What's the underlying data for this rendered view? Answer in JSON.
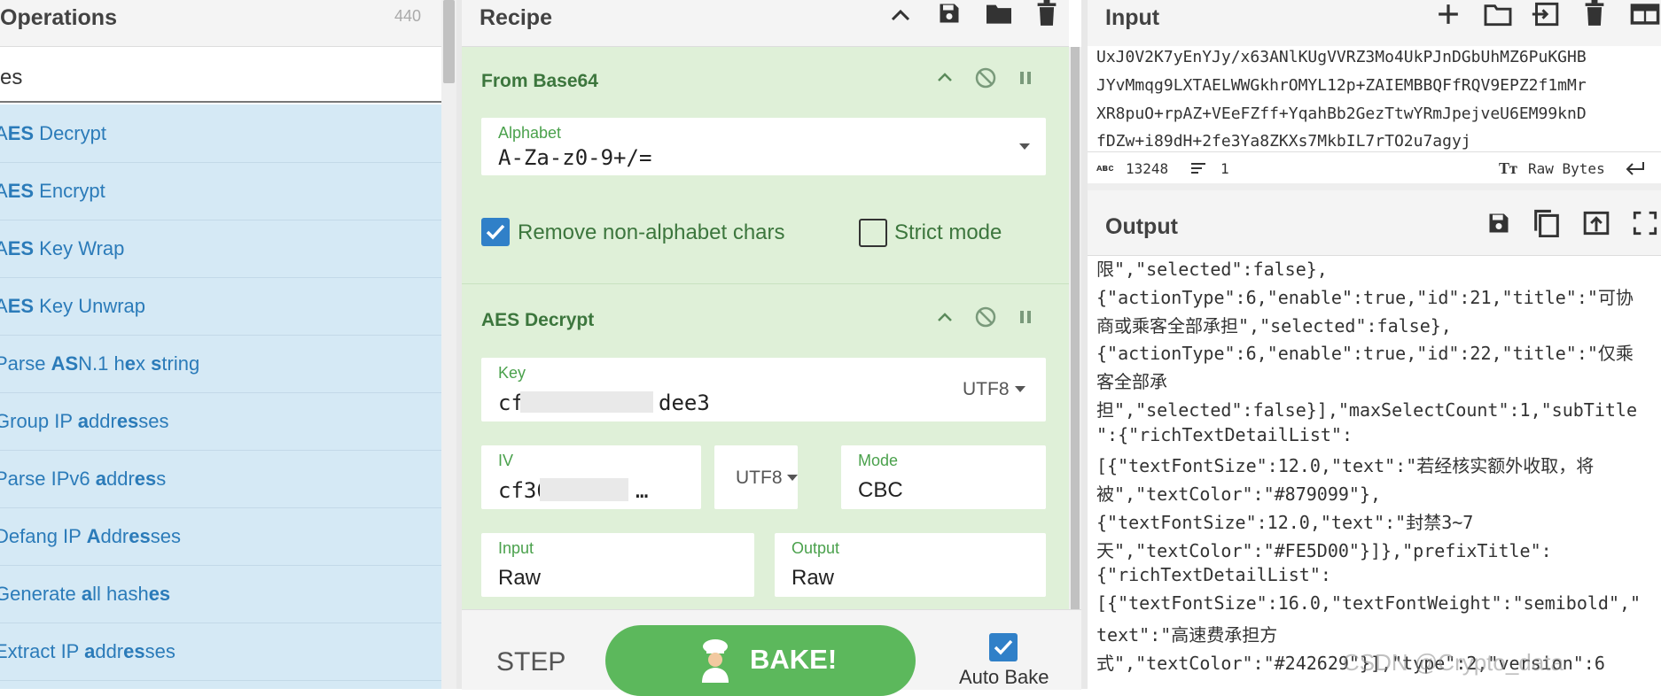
{
  "operations": {
    "title": "Operations",
    "count": "440",
    "search_value": "es",
    "items": [
      {
        "name": "aes-decrypt",
        "label": "AES Decrypt"
      },
      {
        "name": "aes-encrypt",
        "label": "AES Encrypt"
      },
      {
        "name": "aes-key-wrap",
        "label": "AES Key Wrap"
      },
      {
        "name": "aes-key-unwrap",
        "label": "AES Key Unwrap"
      },
      {
        "name": "parse-asn1",
        "label": "Parse ASN.1 hex string"
      },
      {
        "name": "group-ip",
        "label": "Group IP addresses"
      },
      {
        "name": "parse-ipv6",
        "label": "Parse IPv6 address"
      },
      {
        "name": "defang-ip",
        "label": "Defang IP Addresses"
      },
      {
        "name": "generate-hashes",
        "label": "Generate all hashes"
      },
      {
        "name": "extract-ip",
        "label": "Extract IP addresses"
      }
    ]
  },
  "recipe": {
    "title": "Recipe",
    "from_base64": {
      "title": "From Base64",
      "alphabet_label": "Alphabet",
      "alphabet_value": "A-Za-z0-9+/=",
      "remove_nonalpha_label": "Remove non-alphabet chars",
      "remove_nonalpha_checked": true,
      "strict_mode_label": "Strict mode",
      "strict_mode_checked": false
    },
    "aes_decrypt": {
      "title": "AES Decrypt",
      "key_label": "Key",
      "key_value": "cf",
      "key_value_tail": "dee3",
      "key_encoding": "UTF8",
      "iv_label": "IV",
      "iv_value": "cf36",
      "iv_value_tail": "…",
      "iv_encoding": "UTF8",
      "mode_label": "Mode",
      "mode_value": "CBC",
      "input_label": "Input",
      "input_value": "Raw",
      "output_label": "Output",
      "output_value": "Raw"
    },
    "step_label": "STEP",
    "bake_label": "BAKE!",
    "autobake_label": "Auto Bake",
    "autobake_checked": true
  },
  "input": {
    "title": "Input",
    "lines": [
      "UxJ0V2K7yEnYJy/x63ANlKUgVVRZ3Mo4UkPJnDGbUhMZ6PuKGHB",
      "JYvMmqg9LXTAELWWGkhrOMYL12p+ZAIEMBBQFfRQV9EPZ2f1mMr",
      "XR8puO+rpAZ+VEeFZff+YqahBb2GezTtwYRmJpejveU6EM99knD",
      "fDZw+i89dH+2fe3Ya8ZKXs7MkbIL7rTO2u7agyj"
    ],
    "char_count": "13248",
    "line_count": "1",
    "encoding": "Raw Bytes"
  },
  "output": {
    "title": "Output",
    "lines": [
      "限\",\"selected\":false},",
      "{\"actionType\":6,\"enable\":true,\"id\":21,\"title\":\"可协",
      "商或乘客全部承担\",\"selected\":false},",
      "{\"actionType\":6,\"enable\":true,\"id\":22,\"title\":\"仅乘",
      "客全部承",
      "担\",\"selected\":false}],\"maxSelectCount\":1,\"subTitle",
      "\":{\"richTextDetailList\":",
      "[{\"textFontSize\":12.0,\"text\":\"若经核实额外收取，将",
      "被\",\"textColor\":\"#879099\"},",
      "{\"textFontSize\":12.0,\"text\":\"封禁3~7",
      "天\",\"textColor\":\"#FE5D00\"}]},\"prefixTitle\":",
      "{\"richTextDetailList\":",
      "[{\"textFontSize\":16.0,\"textFontWeight\":\"semibold\",\"",
      "text\":\"高速费承担方",
      "式\",\"textColor\":\"#242629\"}],\"type\":2,\"version\":6"
    ],
    "watermark": "CSDN @Crypto_data"
  }
}
